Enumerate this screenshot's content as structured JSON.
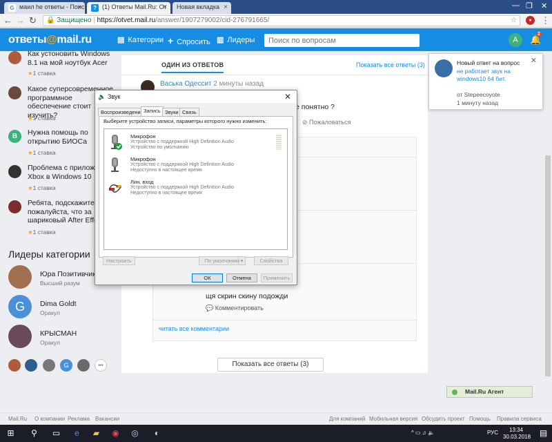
{
  "browser": {
    "tabs": [
      {
        "label": "мaил he ответы - Поиск",
        "icon": "google-icon"
      },
      {
        "label": "(1) Ответы Mail.Ru: От",
        "icon": "otvet-icon"
      },
      {
        "label": "Новая вкладка",
        "icon": ""
      }
    ],
    "address": {
      "secure_label": "Защищено",
      "host": "https://otvet.mail.ru",
      "path": "/answer/1907279002/cid-276791665/"
    }
  },
  "header": {
    "logo_left": "ответы",
    "logo_at": "@",
    "logo_right": "mail.ru",
    "nav": [
      {
        "icon": "categories-icon",
        "label": "Категории"
      },
      {
        "icon": "plus-icon",
        "label": "Спросить"
      },
      {
        "icon": "leaders-icon",
        "label": "Лидеры"
      }
    ],
    "search_placeholder": "Поиск по вопросам",
    "avatar_letter": "A",
    "notif_count": "2"
  },
  "left": {
    "questions": [
      {
        "text": "Как устоновить Windows 8.1 на мой ноутбук Acer",
        "bet": "1 ставка",
        "avatar_letter": "",
        "avatar_color": "#b05a3c"
      },
      {
        "text": "Какое суперсовременное программное обеспечение стоит изучить?",
        "bet": "1 ставка",
        "avatar_letter": "",
        "avatar_color": "#6b4a3a"
      },
      {
        "text": "Нужна помощь по открытию БИОСа",
        "bet": "1 ставка",
        "avatar_letter": "B",
        "avatar_color": "#3db37c"
      },
      {
        "text": "Проблема с приложением Xbox в Windows 10",
        "bet": "1 ставка",
        "avatar_letter": "",
        "avatar_color": "#333333"
      },
      {
        "text": "Ребята, подскажите пожалуйста, что за шариковый After Effects",
        "bet": "1 ставка",
        "avatar_letter": "",
        "avatar_color": "#7a2d2d"
      }
    ],
    "leaders_title": "Лидеры категории",
    "leaders": [
      {
        "name": "Юра Позитивчик",
        "rank": "Высший разум",
        "letter": "",
        "color": "#a07050"
      },
      {
        "name": "Dima Goldt",
        "rank": "Оракул",
        "letter": "G",
        "color": "#4a90d9"
      },
      {
        "name": "КРЫСМАН",
        "rank": "Оракул",
        "letter": "",
        "color": "#6a4a5a"
      }
    ],
    "more": "•••"
  },
  "answer": {
    "tab_title": "ОДИН ИЗ ОТВЕТОВ",
    "show_all_link": "Показать все ответы (3)",
    "author": "Васька Одессит",
    "time": "2 минуты назад",
    "tail_text": "е понятно ?",
    "complain": "Пожаловаться",
    "comment_text": "щя скрин скину подожди",
    "comment_link": "Комментировать",
    "read_all": "читать все комментарии",
    "show_all_button": "Показать все ответы (3)"
  },
  "dialog": {
    "title": "Звук",
    "tabs": [
      "Воспроизведение",
      "Запись",
      "Звуки",
      "Связь"
    ],
    "instruction": "Выберите устройство записи, параметры которого нужно изменить:",
    "devices": [
      {
        "name": "Микрофон",
        "desc1": "Устройство с поддержкой High Definition Audio",
        "desc2": "Устройство по умолчанию"
      },
      {
        "name": "Микрофон",
        "desc1": "Устройство с поддержкой High Definition Audio",
        "desc2": "Недоступно в настоящее время"
      },
      {
        "name": "Лин. вход",
        "desc1": "Устройство с поддержкой High Definition Audio",
        "desc2": "Недоступно в настоящее время"
      }
    ],
    "btn_configure": "Настроить",
    "btn_default": "По умолчанию",
    "btn_properties": "Свойства",
    "btn_ok": "ОК",
    "btn_cancel": "Отмена",
    "btn_apply": "Применить"
  },
  "notification": {
    "heading": "Новый ответ на вопрос",
    "link": "не работает звук на windows10 64 бит.",
    "from": "от Stepeecoyote",
    "time": "1 минуту назад"
  },
  "agent_label": "Mail.Ru Агент",
  "footer": {
    "left": [
      "Mail.Ru",
      "О компании",
      "Реклама",
      "Вакансии"
    ],
    "right": [
      "Для компаний",
      "Мобильная версия",
      "Обсудить проект",
      "Помощь",
      "Правила сервиса"
    ]
  },
  "taskbar": {
    "lang": "РУС",
    "time": "13:34",
    "date": "30.03.2018"
  }
}
